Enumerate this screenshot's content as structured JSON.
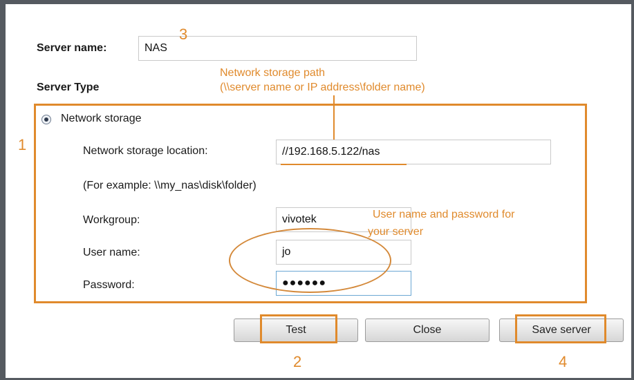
{
  "form": {
    "server_name_label": "Server name:",
    "server_name_value": "NAS",
    "server_type_label": "Server Type",
    "radio_network_storage_label": "Network storage",
    "location_label": "Network storage location:",
    "location_value": "//192.168.5.122/nas",
    "example_text": "(For example: \\\\my_nas\\disk\\folder)",
    "workgroup_label": "Workgroup:",
    "workgroup_value": "vivotek",
    "username_label": "User name:",
    "username_value": "jo",
    "password_label": "Password:",
    "password_value": "●●●●●●"
  },
  "buttons": {
    "test": "Test",
    "close": "Close",
    "save": "Save server"
  },
  "annotations": {
    "num_1": "1",
    "num_2": "2",
    "num_3": "3",
    "num_4": "4",
    "path_note_line1": "Network storage path",
    "path_note_line2": "(\\\\server name or IP address\\folder name)",
    "cred_note_line1": "User name and password for",
    "cred_note_line2": "your server",
    "accent_color": "#e08a2c"
  }
}
